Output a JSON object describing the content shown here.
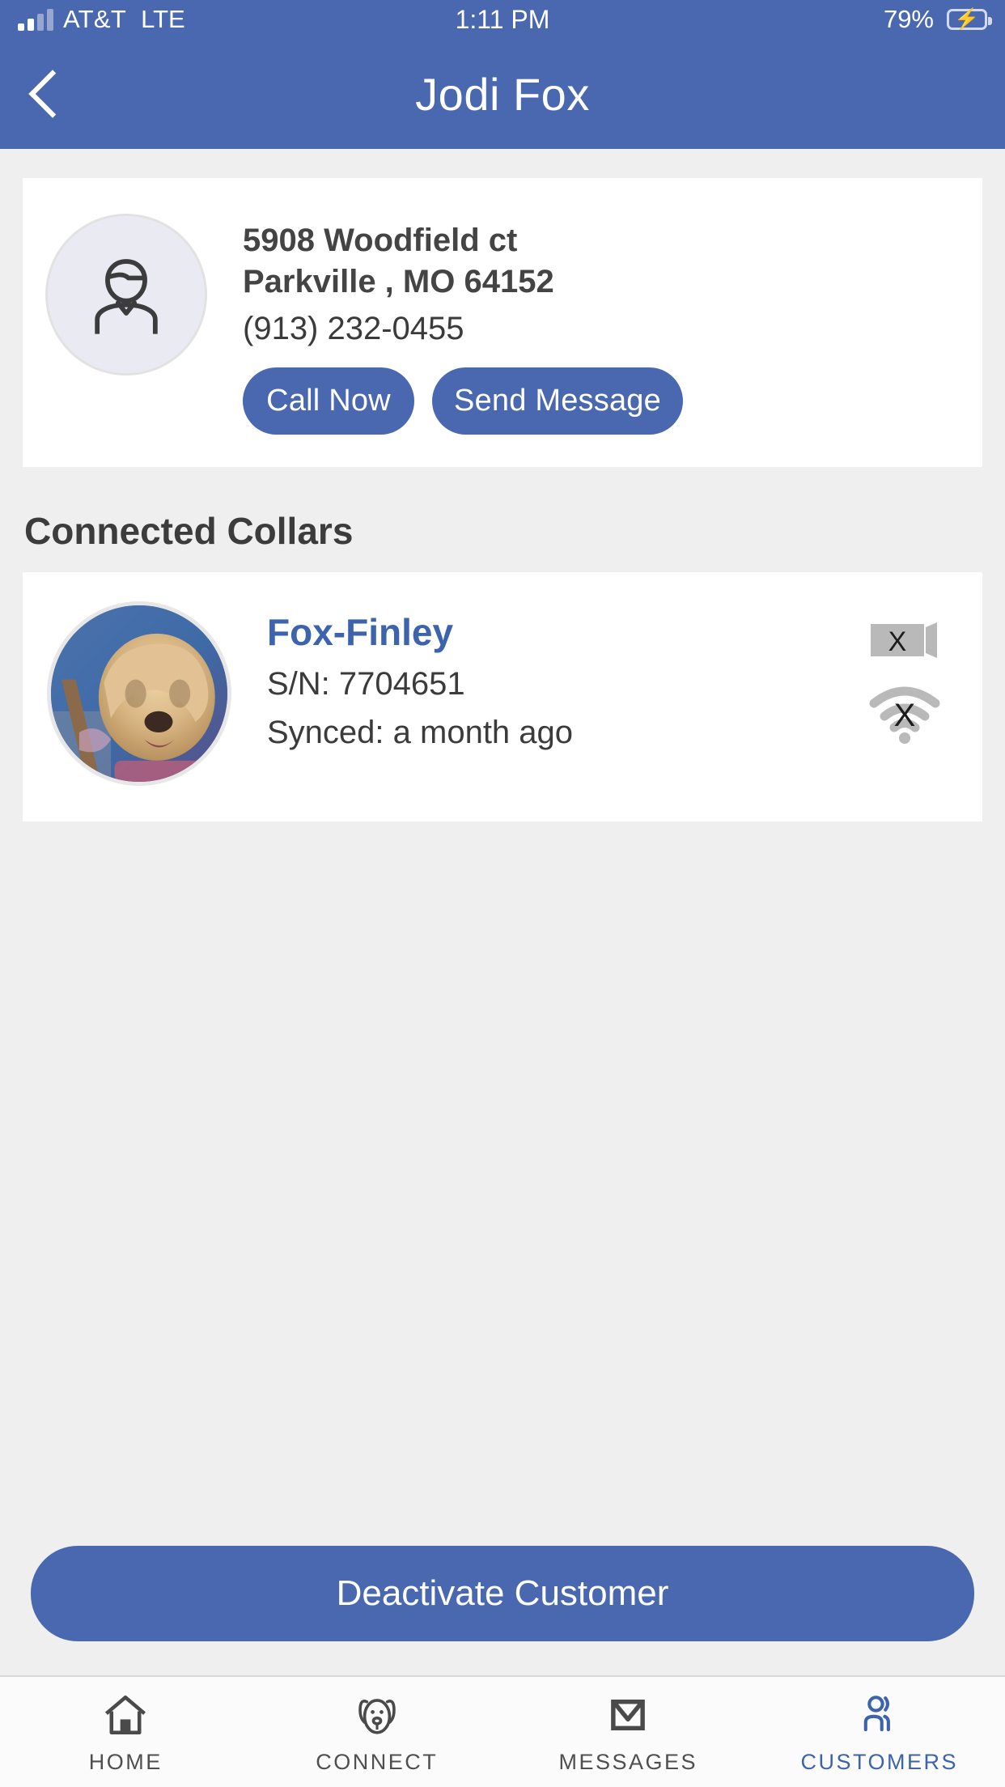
{
  "status_bar": {
    "carrier": "AT&T",
    "network": "LTE",
    "time": "1:11 PM",
    "battery_percent": "79%",
    "battery_charging": true,
    "signal_bars": 2
  },
  "header": {
    "title": "Jodi Fox",
    "back_icon": "chevron-left-icon",
    "background_color": "#4a68b0"
  },
  "contact": {
    "avatar_icon": "person-placeholder-icon",
    "address_line1": "5908 Woodfield ct",
    "address_line2": "Parkville , MO 64152",
    "phone": "(913) 232-0455",
    "call_button": "Call Now",
    "message_button": "Send Message"
  },
  "collars_section": {
    "title": "Connected Collars",
    "items": [
      {
        "name": "Fox-Finley",
        "serial": "S/N: 7704651",
        "synced": "Synced: a month ago",
        "photo": "dog-photo-goldendoodle",
        "battery_status_icon": "battery-unknown-icon",
        "battery_status": "X",
        "wifi_status_icon": "wifi-unknown-icon",
        "wifi_status": "X"
      }
    ]
  },
  "actions": {
    "deactivate_label": "Deactivate Customer"
  },
  "tab_bar": {
    "active": "CUSTOMERS",
    "accent_color": "#3c63ab",
    "tabs": [
      {
        "label": "HOME",
        "icon": "home-icon"
      },
      {
        "label": "CONNECT",
        "icon": "dog-face-icon"
      },
      {
        "label": "MESSAGES",
        "icon": "envelope-icon"
      },
      {
        "label": "CUSTOMERS",
        "icon": "people-icon"
      }
    ]
  }
}
